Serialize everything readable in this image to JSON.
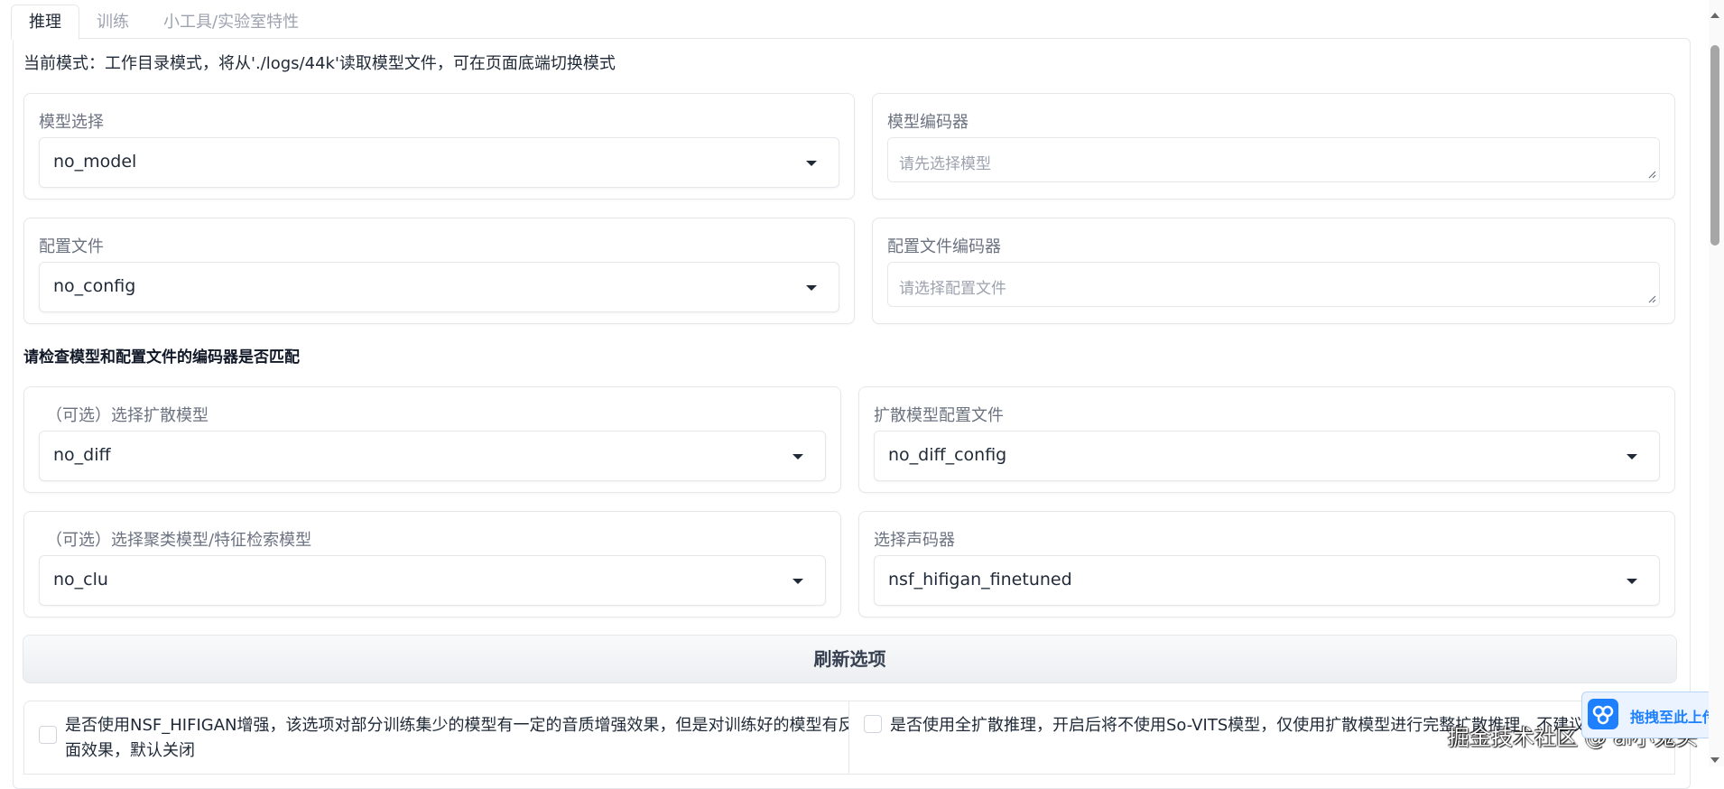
{
  "tabs": [
    "推理",
    "训练",
    "小工具/实验室特性"
  ],
  "mode_text": "当前模式：工作目录模式，将从'./logs/44k'读取模型文件，可在页面底端切换模式",
  "model_select": {
    "label": "模型选择",
    "value": "no_model"
  },
  "model_encoder": {
    "label": "模型编码器",
    "placeholder": "请先选择模型"
  },
  "config_file": {
    "label": "配置文件",
    "value": "no_config"
  },
  "config_encoder": {
    "label": "配置文件编码器",
    "placeholder": "请选择配置文件"
  },
  "hint": "请检查模型和配置文件的编码器是否匹配",
  "diff_model": {
    "label": "（可选）选择扩散模型",
    "value": "no_diff"
  },
  "diff_config": {
    "label": "扩散模型配置文件",
    "value": "no_diff_config"
  },
  "cluster_model": {
    "label": "（可选）选择聚类模型/特征检索模型",
    "value": "no_clu"
  },
  "vocoder": {
    "label": "选择声码器",
    "value": "nsf_hifigan_finetuned"
  },
  "refresh_button": "刷新选项",
  "nsf_enhance": {
    "line1": "是否使用NSF_HIFIGAN增强，该选项对部分训练集少的模型有一定的音质增强效果，但是对训练好的模型有反",
    "line2": "面效果，默认关闭",
    "checked": false
  },
  "full_diffusion": {
    "label": "是否使用全扩散推理，开启后将不使用So-VITS模型，仅使用扩散模型进行完整扩散推理，不建议使",
    "checked": false
  },
  "upload_widget": "拖拽至此上传",
  "watermark": "掘金技术社区 @ ai小鬼头",
  "colors": {
    "accent": "#1e80ff",
    "border": "#e5e7eb",
    "muted": "#6b7280"
  }
}
